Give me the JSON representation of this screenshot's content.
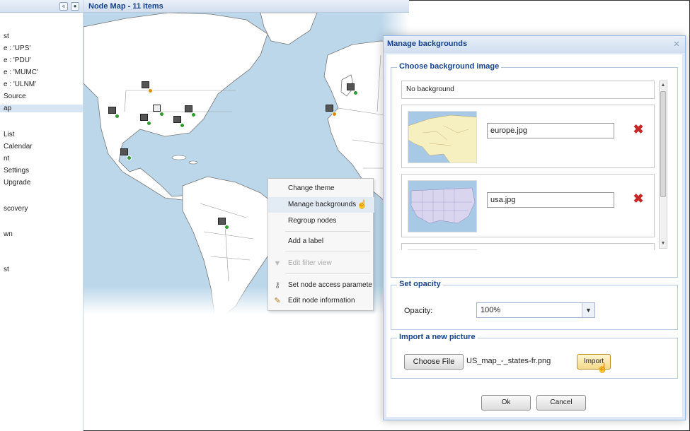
{
  "sidebar": {
    "collapse_icon": "double-chevron-left",
    "settings_icon": "gear",
    "items": [
      "st",
      "e : 'UPS'",
      "e : 'PDU'",
      "e : 'MUMC'",
      "e : 'ULNM'",
      "Source",
      "ap",
      "List",
      "Calendar",
      "nt",
      "Settings",
      "Upgrade",
      "scovery",
      "wn",
      "st"
    ],
    "selected_index": 6
  },
  "map": {
    "title": "Node Map - 11 Items"
  },
  "context_menu": {
    "items": [
      {
        "label": "Change theme",
        "icon": "",
        "disabled": false
      },
      {
        "label": "Manage backgrounds",
        "icon": "",
        "disabled": false,
        "hover": true
      },
      {
        "label": "Regroup nodes",
        "icon": "",
        "disabled": false
      },
      {
        "label": "Add a label",
        "icon": "",
        "disabled": false
      },
      {
        "label": "Edit filter view",
        "icon": "funnel-icon",
        "disabled": true
      },
      {
        "label": "Set node access paramete",
        "icon": "key-icon",
        "disabled": false
      },
      {
        "label": "Edit node information",
        "icon": "pencil-icon",
        "disabled": false
      }
    ]
  },
  "dialog": {
    "title": "Manage backgrounds",
    "choose_section": {
      "legend": "Choose background image",
      "no_background": "No background",
      "backgrounds": [
        {
          "filename": "europe.jpg",
          "delete_icon": "red-x-icon"
        },
        {
          "filename": "usa.jpg",
          "delete_icon": "red-x-icon"
        }
      ]
    },
    "opacity_section": {
      "legend": "Set opacity",
      "label": "Opacity:",
      "value": "100%"
    },
    "import_section": {
      "legend": "Import a new picture",
      "choose_file_label": "Choose File",
      "file_name": "US_map_-_states-fr.png",
      "import_label": "Import"
    },
    "ok_label": "Ok",
    "cancel_label": "Cancel"
  },
  "colors": {
    "accent": "#15428b",
    "water": "#bcd7ea",
    "land": "#ffffff",
    "status_ok": "#2e9e2e",
    "status_warn": "#e08a00",
    "delete": "#c62828"
  }
}
